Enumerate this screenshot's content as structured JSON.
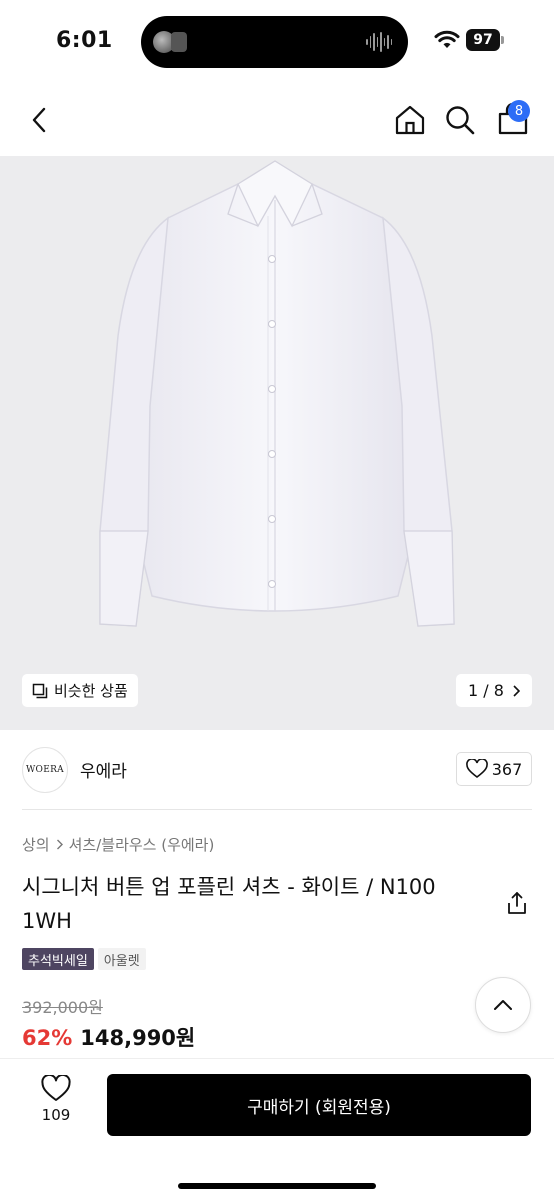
{
  "status": {
    "time": "6:01",
    "battery": "97"
  },
  "nav": {
    "cart_count": "8"
  },
  "gallery": {
    "similar_label": "비슷한 상품",
    "pager": "1 / 8"
  },
  "brand": {
    "logo_text": "WOERA",
    "name": "우에라",
    "likes": "367"
  },
  "product": {
    "breadcrumb": [
      "상의",
      "셔츠/블라우스 (우에라)"
    ],
    "title": "시그니처 버튼 업 포플린 셔츠 - 화이트 / N100 1WH",
    "tags": {
      "sale": "추석빅세일",
      "outlet": "아울렛"
    },
    "original_price": "392,000원",
    "discount": "62%",
    "price": "148,990원"
  },
  "bottom": {
    "wish_count": "109",
    "buy_label": "구매하기 (회원전용)"
  },
  "colors": {
    "accent_blue": "#2d6df6",
    "sale_red": "#e53935",
    "tag_purple": "#4e4561"
  }
}
